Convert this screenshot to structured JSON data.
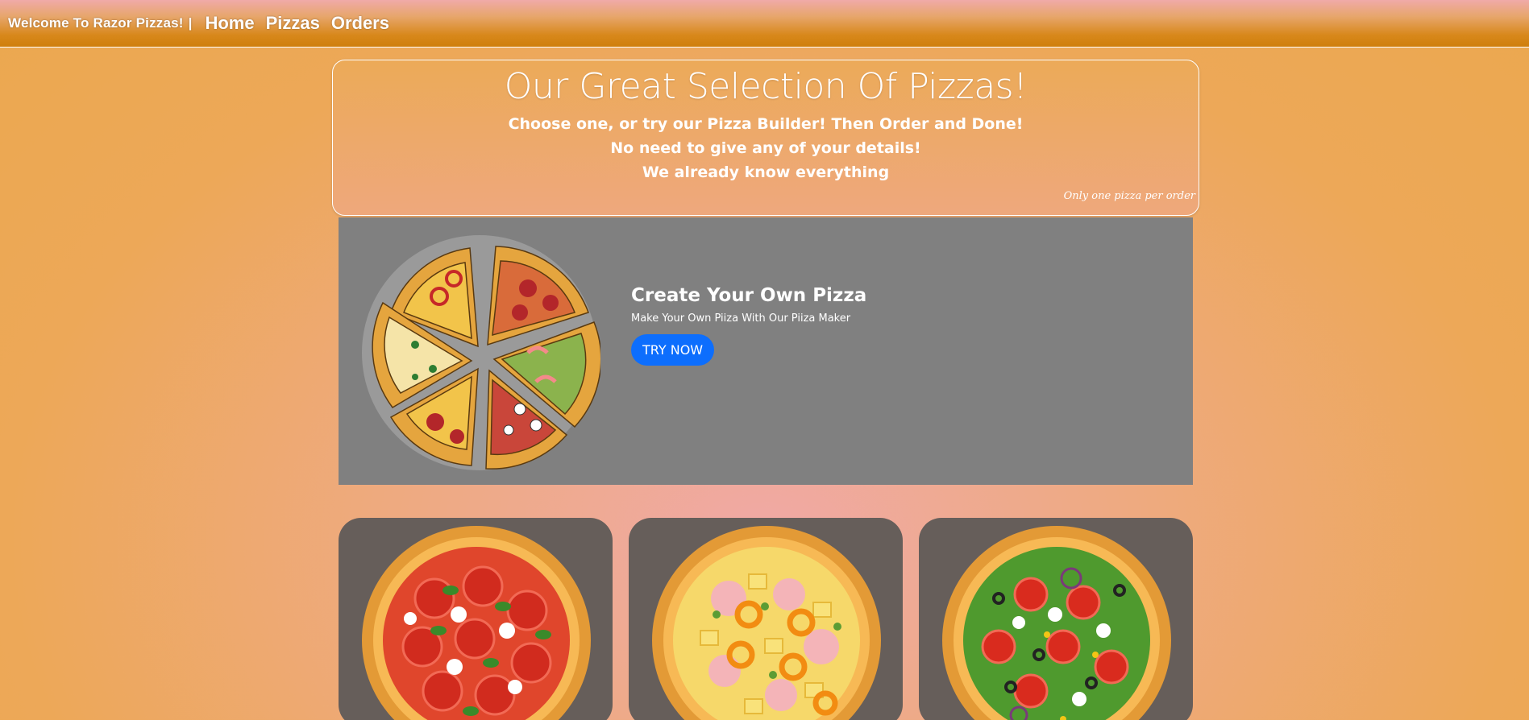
{
  "navbar": {
    "brand": "Welcome To Razor Pizzas!",
    "separator": "|",
    "links": [
      "Home",
      "Pizzas",
      "Orders"
    ]
  },
  "hero": {
    "title": "Our Great Selection Of Pizzas!",
    "lines": [
      "Choose one, or try our Pizza Builder! Then Order and Done!",
      "No need to give any of your details!",
      "We already know everything"
    ],
    "note": "Only one pizza per order"
  },
  "promo": {
    "title": "Create Your Own Pizza",
    "subtitle": "Make Your Own Piiza With Our Piiza Maker",
    "button_label": "TRY NOW",
    "image_icon": "sliced-pizza-image"
  },
  "pizza_cards": [
    {
      "image_icon": "tomato-basil-pizza-image"
    },
    {
      "image_icon": "ham-pineapple-pizza-image"
    },
    {
      "image_icon": "veggie-olive-pizza-image"
    }
  ],
  "colors": {
    "button_blue": "#0d6efd",
    "promo_gray": "#808080",
    "card_bg": "#665e5a"
  }
}
